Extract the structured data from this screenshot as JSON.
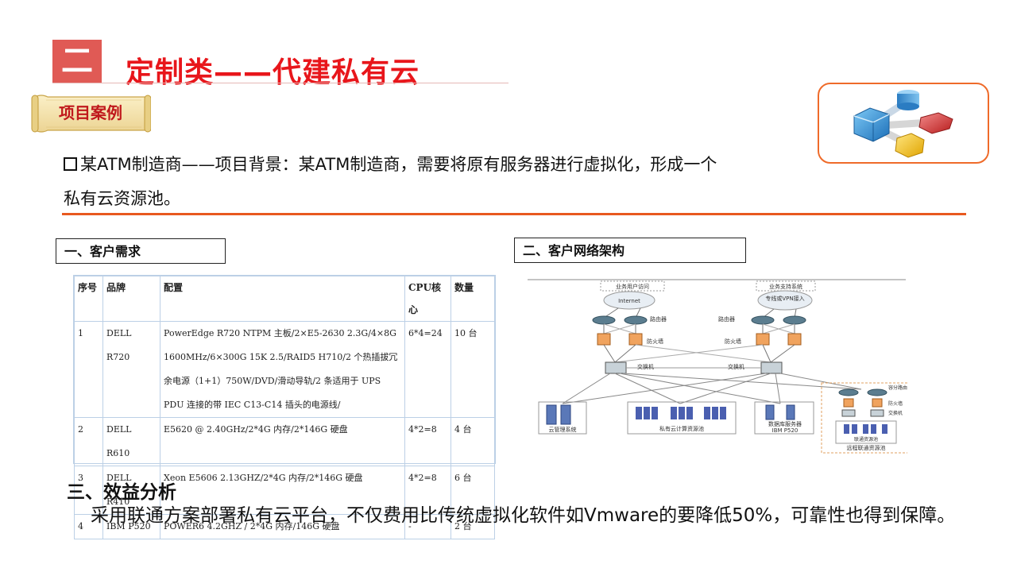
{
  "header": {
    "section_number": "二",
    "title": "定制类——代建私有云"
  },
  "case_tag": "项目案例",
  "background": {
    "line1": "某ATM制造商——项目背景：某ATM制造商，需要将原有服务器进行虚拟化，形成一个",
    "line2": "私有云资源池。"
  },
  "requirements": {
    "label": "一、客户需求",
    "headers": [
      "序号",
      "品牌",
      "配置",
      "CPU核心",
      "数量"
    ],
    "rows": [
      {
        "no": "1",
        "brand": "DELL R720",
        "config": "PowerEdge R720 NTPM 主板/2×E5-2630 2.3G/4×8G 1600MHz/6×300G 15K 2.5/RAID5 H710/2 个热插拔冗余电源（1+1）750W/DVD/滑动导轨/2 条适用于 UPS PDU 连接的带 IEC C13-C14 插头的电源线/",
        "cpu": "6*4=24",
        "qty": "10 台"
      },
      {
        "no": "2",
        "brand": "DELL R610",
        "config": "E5620 @ 2.40GHz/2*4G 内存/2*146G 硬盘",
        "cpu": "4*2=8",
        "qty": "4 台"
      },
      {
        "no": "3",
        "brand": "DELL R410",
        "config": "Xeon E5606 2.13GHZ/2*4G 内存/2*146G 硬盘",
        "cpu": "4*2=8",
        "qty": "6 台"
      },
      {
        "no": "4",
        "brand": "IBM P520",
        "config": "POWER6 4.2GHZ / 2*4G 内存/146G 硬盘",
        "cpu": "-",
        "qty": "2 台"
      }
    ]
  },
  "network": {
    "label": "二、客户网络架构",
    "business_user_access": "业务用户访问",
    "business_support": "业务支持系统",
    "internet": "Internet",
    "vpn": "专线或VPN接入",
    "router": "路由器",
    "firewall": "防火墙",
    "switch": "交换机",
    "cloud_mgmt": "云管理系统",
    "private_pool": "私有云计算资源池",
    "db_server": "数据库服务器",
    "db_model": "IBM P520",
    "remote_router": "容分路由器",
    "remote_res": "联通资源池",
    "remote_pool": "远程联通资源池"
  },
  "benefit": {
    "heading": "三、效益分析",
    "text": "采用联通方案部署私有云平台，不仅费用比传统虚拟化软件如Vmware的要降低50%，可靠性也得到保障。"
  },
  "colors": {
    "title_red": "#e8161b",
    "section_box": "#e05a55",
    "rule_orange": "#e8591f",
    "tag_red": "#c0181c"
  }
}
